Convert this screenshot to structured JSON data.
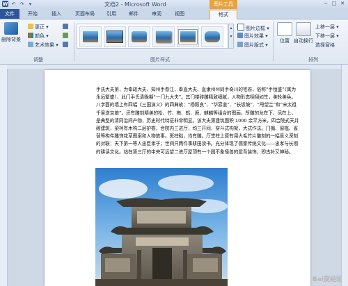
{
  "title_bar": {
    "document_title": "文档2 - Microsoft Word",
    "contextual_group": "图片工具",
    "quick_access": [
      "W",
      "↶",
      "↷",
      "▾"
    ],
    "window_controls": [
      "─",
      "□",
      "✕"
    ]
  },
  "tabs": [
    {
      "label": "文件"
    },
    {
      "label": "开始"
    },
    {
      "label": "插入"
    },
    {
      "label": "页面布局"
    },
    {
      "label": "引用"
    },
    {
      "label": "邮件"
    },
    {
      "label": "审阅"
    },
    {
      "label": "视图"
    },
    {
      "label": "格式"
    }
  ],
  "ribbon": {
    "remove_background": "删除背景",
    "correction": "更正 ▾",
    "color": "颜色 ▾",
    "art_effects": "艺术效果 ▾",
    "group_adjust": "调整",
    "group_picture_styles": "图片样式",
    "picture_border": "图片边框 ▾",
    "picture_effects": "图片效果 ▾",
    "picture_layout": "图片版式 ▾",
    "position": "位置",
    "wrap_text": "自动换行",
    "bring_forward": "上移一层 ▾",
    "send_backward": "下移一层 ▾",
    "selection_pane": "选择窗格",
    "group_arrange": "排列"
  },
  "document": {
    "paragraph": "手氏大夫第，为奉政大夫、知州手春江，奉直大夫、直隶州州同手奇川的宅府，俗称“手恒盛”（寓为永远繁盛），此门手氏清晚期“一门九大夫”。其门楼砖雕精致细腻，人物形态栩栩如生，美轮美奂。八字面的墙上有四幅《三国演义》的四典故：“杨颇良”、“华容道”、“长坂坡”、“甩望兰”和“宋太祖千里送京娘”，还有雕刻精美的松、竹、梅、鹤、鹿、麒麟等组合的图画。所雕的龙在下、凤在上，是典型的清同治间产物，历史时代特征非常明显。该大夫第建筑面积 1000 余平方米，四合院式天井砌建筑，梁柯有木构二层护檐，合院内三进厅，均三开间，穿斗式构架，大式作法。门楣、窗槛、雀替等构件雕饰花草图案和人物故事。斑柱础，均有雕。厅堂柱上原有用大毛竹片雕刻的一幅意义深刻的对联：天下第一等人忠臣孝子；世间只两件事耕田读书。充分体现了儒家传统文化——忠孝与长期的耕读文化。站在第三厅的中央可远望二进厅屋顶有一个圆不象怪兽的屋背装饰，即古补又神秘。"
  },
  "watermark": "Bai度经验"
}
